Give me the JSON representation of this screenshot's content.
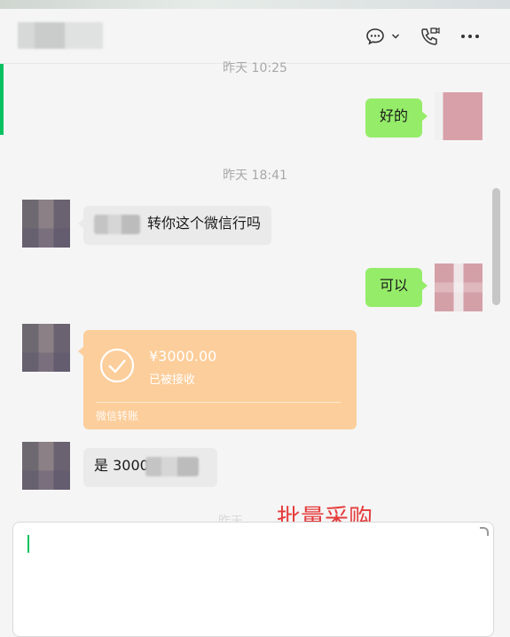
{
  "header": {
    "contact_name": "",
    "icons": [
      "chat-icon",
      "chevron-down-icon",
      "video-call-icon",
      "more-icon"
    ]
  },
  "messages": [
    {
      "type": "time",
      "text": "昨天 10:25"
    },
    {
      "type": "text",
      "from": "me",
      "text": "好的"
    },
    {
      "type": "time",
      "text": "昨天 18:41"
    },
    {
      "type": "text",
      "from": "other",
      "text": "转你这个微信行吗"
    },
    {
      "type": "text",
      "from": "me",
      "text": "可以"
    },
    {
      "type": "transfer",
      "from": "other",
      "amount": "¥3000.00",
      "status": "已被接收",
      "footer": "微信转账"
    },
    {
      "type": "text",
      "from": "other",
      "text": "是 3000"
    }
  ],
  "overlay_text": "批量采购",
  "input": {
    "value": ""
  },
  "colors": {
    "my_bubble": "#95ec69",
    "other_bubble": "#eaeaea",
    "transfer": "#fcce9b",
    "accent": "#07c160",
    "overlay": "#e53c3c"
  }
}
